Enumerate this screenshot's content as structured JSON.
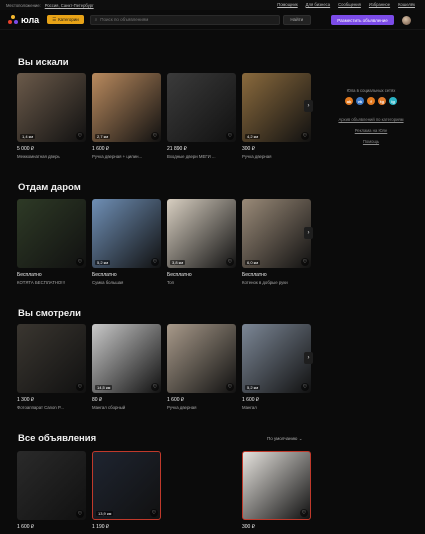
{
  "topbar": {
    "location_label": "Местоположение:",
    "location_value": "Россия, Санкт-Петербург",
    "links": [
      "Помощник",
      "Для бизнеса",
      "Сообщения",
      "Избранное",
      "Кошелёк"
    ]
  },
  "header": {
    "logo_text": "юла",
    "categories_label": "Категории",
    "search_placeholder": "Поиск по объявлениям",
    "find_label": "Найти",
    "post_label": "Разместить объявление"
  },
  "sections": [
    {
      "title": "Вы искали",
      "items": [
        {
          "price": "5 000 ₽",
          "title": "Межкомнатная дверь",
          "dist": "1,4 км",
          "color": "#6b5a4a"
        },
        {
          "price": "1 600 ₽",
          "title": "Ручка дверная + цилин...",
          "dist": "2,7 км",
          "color": "#b98a5e"
        },
        {
          "price": "21 890 ₽",
          "title": "Входные двери МЕГИ ...",
          "dist": "",
          "color": "#3b3b3b"
        },
        {
          "price": "300 ₽",
          "title": "Ручка дверная",
          "dist": "4,2 км",
          "color": "#8a6a3d"
        }
      ]
    },
    {
      "title": "Отдам даром",
      "items": [
        {
          "price": "Бесплатно",
          "title": "КОТЯТА БЕСПЛАТНО!!!",
          "dist": "",
          "color": "#2e3a26"
        },
        {
          "price": "Бесплатно",
          "title": "Сумка большая",
          "dist": "5,2 км",
          "color": "#6f8fb5"
        },
        {
          "price": "Бесплатно",
          "title": "Топ",
          "dist": "3,8 км",
          "color": "#d8cfc1"
        },
        {
          "price": "Бесплатно",
          "title": "Котенок в добрые руки",
          "dist": "6,0 км",
          "color": "#9a8a78"
        }
      ]
    },
    {
      "title": "Вы смотрели",
      "items": [
        {
          "price": "1 300 ₽",
          "title": "Фотоаппарат Canon P...",
          "dist": "",
          "color": "#3a3630"
        },
        {
          "price": "80 ₽",
          "title": "Мангал сборный",
          "dist": "14,5 км",
          "color": "#c9c9c9"
        },
        {
          "price": "1 600 ₽",
          "title": "Ручка дверная",
          "dist": "",
          "color": "#a89a8a"
        },
        {
          "price": "1 600 ₽",
          "title": "Мангал",
          "dist": "5,2 км",
          "color": "#7c8796"
        }
      ]
    },
    {
      "title": "Все объявления",
      "items": [
        {
          "price": "1 600 ₽",
          "title": "",
          "dist": "",
          "color": "#2a2a2a"
        },
        {
          "price": "1 190 ₽",
          "title": "",
          "dist": "13,9 км",
          "color": "#1e2430"
        },
        {
          "price": "300 ₽",
          "title": "",
          "dist": "",
          "color": "#e5e2dd"
        }
      ]
    }
  ],
  "sidebar": {
    "social_title": "Юла в социальных сетях",
    "social": [
      {
        "letter": "ok",
        "color": "#e37a1f"
      },
      {
        "letter": "vk",
        "color": "#3a76c4"
      },
      {
        "letter": "f",
        "color": "#e37a1f"
      },
      {
        "letter": "tg",
        "color": "#e07a2b"
      },
      {
        "letter": "ig",
        "color": "#2ab3c4"
      }
    ],
    "links": [
      "Архив объявлений по категориям",
      "Реклама на Юле",
      "Помощь"
    ]
  },
  "sort_label": "По умолчанию"
}
